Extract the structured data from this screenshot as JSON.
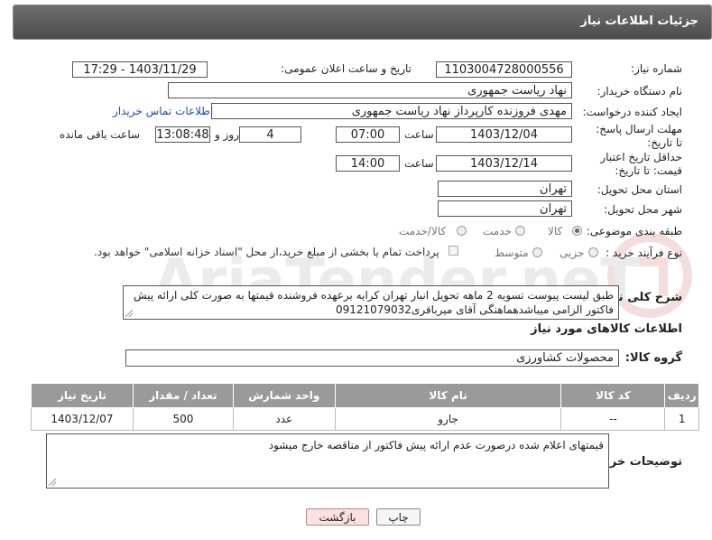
{
  "header": {
    "title": "جزئیات اطلاعات نیاز"
  },
  "form": {
    "need_number_label": "شماره نیاز:",
    "need_number": "1103004728000556",
    "announce_label": "تاریخ و ساعت اعلان عمومی:",
    "announce_value": "1403/11/29 - 17:29",
    "buyer_org_label": "نام دستگاه خریدار:",
    "buyer_org": "نهاد ریاست جمهوری",
    "creator_label": "ایجاد کننده درخواست:",
    "creator": "مهدی فروزنده کارپرداز نهاد ریاست جمهوری",
    "contact_link": "اطلاعات تماس خریدار",
    "reply_deadline_label": "مهلت ارسال پاسخ: تا تاریخ:",
    "reply_date": "1403/12/04",
    "hour_label": "ساعت",
    "reply_time": "07:00",
    "days_value": "4",
    "days_label": "روز و",
    "remaining_time": "13:08:48",
    "remaining_label": "ساعت باقی مانده",
    "price_validity_label": "حداقل تاریخ اعتبار قیمت: تا تاریخ:",
    "price_date": "1403/12/14",
    "price_time": "14:00",
    "province_label": "استان محل تحویل:",
    "province": "تهران",
    "city_label": "شهر محل تحویل:",
    "city": "تهران",
    "category_label": "طبقه بندی موضوعی:",
    "category_options": [
      "کالا",
      "خدمت",
      "کالا/خدمت"
    ],
    "purchase_type_label": "نوع فرآیند خرید :",
    "purchase_options": [
      "جزیی",
      "متوسط"
    ],
    "payment_note": "پرداخت تمام یا بخشی از مبلغ خرید،از محل \"اسناد خزانه اسلامی\" خواهد بود.",
    "description_label": "شرح کلی نیاز:",
    "description": "طبق لیست پیوست تسویه 2 ماهه تحویل انبار تهران کرایه برعهده فروشنده قیمتها به صورت کلی ارائه پیش فاکتور الزامی میباشدهماهنگی آقای میرباقری09121079032"
  },
  "goods": {
    "section_title": "اطلاعات کالاهای مورد نیاز",
    "group_label": "گروه کالا:",
    "group_value": "محصولات کشاورزی",
    "columns": [
      "ردیف",
      "کد کالا",
      "نام کالا",
      "واحد شمارش",
      "تعداد / مقدار",
      "تاریخ نیاز"
    ],
    "rows": [
      [
        "1",
        "--",
        "جارو",
        "عدد",
        "500",
        "1403/12/07"
      ]
    ]
  },
  "buyer_notes": {
    "label": "توضیحات خریدار:",
    "text": "قیمتهای اعلام شده درصورت عدم ارائه پیش فاکتور از مناقصه خارج میشود"
  },
  "buttons": {
    "print": "چاپ",
    "back": "بازگشت"
  },
  "watermark": {
    "text": "AriaTender.neT"
  }
}
